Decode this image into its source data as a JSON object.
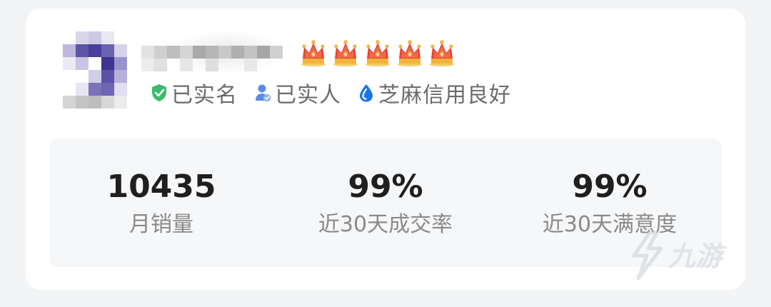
{
  "seller": {
    "crowns": 5,
    "badges": [
      {
        "icon": "shield-check-icon",
        "label": "已实名",
        "color": "#3dba6c"
      },
      {
        "icon": "person-verified-icon",
        "label": "已实人",
        "color": "#5b8de8"
      },
      {
        "icon": "sesame-drop-icon",
        "label": "芝麻信用良好",
        "color": "#1a73e8"
      }
    ]
  },
  "stats": [
    {
      "value": "10435",
      "label": "月销量"
    },
    {
      "value": "99%",
      "label": "近30天成交率"
    },
    {
      "value": "99%",
      "label": "近30天满意度"
    }
  ],
  "watermark": {
    "text": "九游",
    "logo": "9game-logo-icon"
  },
  "colors": {
    "page_bg": "#f3f4f6",
    "card_bg": "#ffffff",
    "stats_bg": "#f6f7f9",
    "crown_red": "#e8412c",
    "crown_gold": "#f2b33d"
  }
}
